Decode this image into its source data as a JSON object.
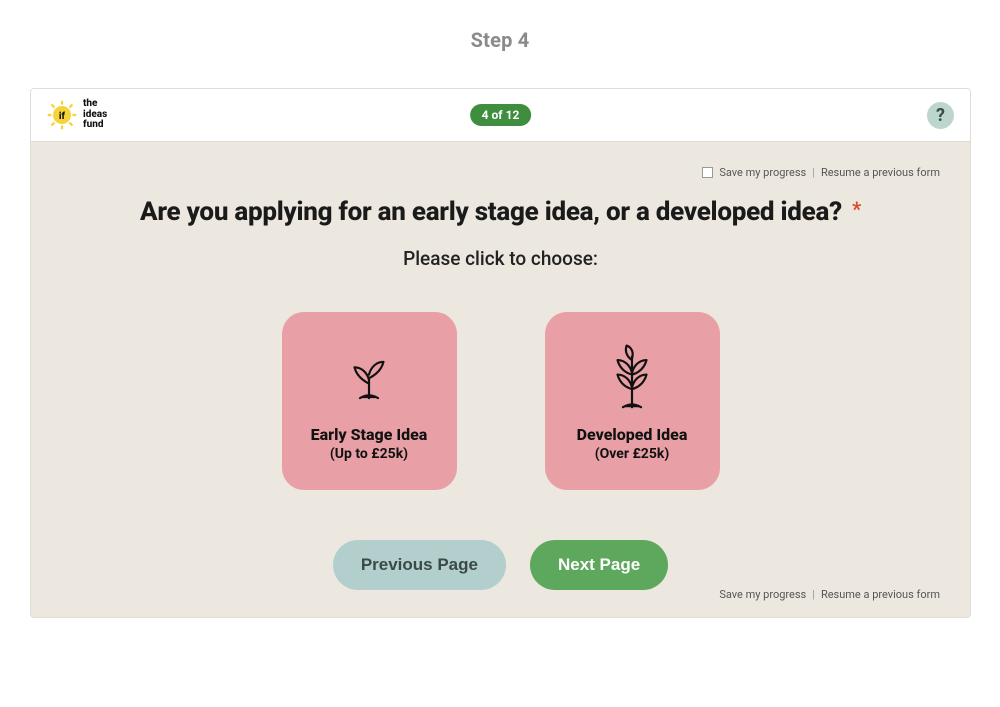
{
  "page": {
    "step_label": "Step 4"
  },
  "header": {
    "logo_text": "the\nideas\nfund",
    "progress_label": "4 of 12",
    "help_glyph": "?"
  },
  "save_bar": {
    "save_label": "Save my progress",
    "resume_label": "Resume a previous form",
    "separator": "|"
  },
  "question": {
    "title": "Are you applying for an early stage idea, or a developed idea?",
    "required_mark": "*",
    "subtitle": "Please click to choose:"
  },
  "choices": [
    {
      "title": "Early Stage Idea",
      "subtitle": "(Up to £25k)"
    },
    {
      "title": "Developed Idea",
      "subtitle": "(Over £25k)"
    }
  ],
  "nav": {
    "previous_label": "Previous Page",
    "next_label": "Next Page"
  }
}
